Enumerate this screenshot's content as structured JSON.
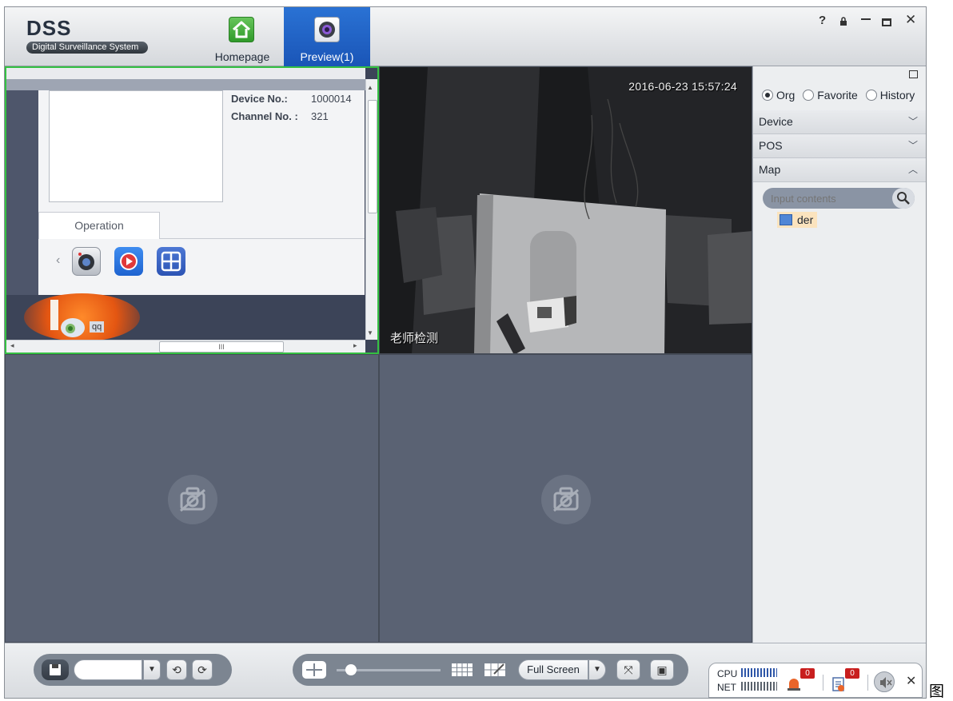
{
  "app": {
    "brand_title": "DSS",
    "brand_subtitle": "Digital Surveillance System",
    "window_controls": [
      "?",
      "lock",
      "minimize",
      "maximize",
      "close"
    ]
  },
  "nav": {
    "tabs": [
      {
        "label": "Homepage",
        "icon": "home-icon",
        "active": false
      },
      {
        "label": "Preview(1)",
        "icon": "camera-preview-icon",
        "active": true
      }
    ]
  },
  "video": {
    "pane1": {
      "device_no_label": "Device No.:",
      "device_no_value": "1000014",
      "channel_no_label": "Channel No. :",
      "channel_no_value": "321",
      "operation_tab": "Operation",
      "app_label": "qq",
      "scrollbar_grip": "III"
    },
    "pane2": {
      "timestamp": "2016-06-23 15:57:24",
      "channel_name": "老师检测"
    }
  },
  "rpanel": {
    "radios": [
      {
        "label": "Org",
        "checked": true
      },
      {
        "label": "Favorite",
        "checked": false
      },
      {
        "label": "History",
        "checked": false
      }
    ],
    "sections": [
      {
        "label": "Device",
        "expanded": false
      },
      {
        "label": "POS",
        "expanded": false
      },
      {
        "label": "Map",
        "expanded": true
      }
    ],
    "search_placeholder": "Input contents",
    "map_item": "der"
  },
  "toolbar": {
    "full_screen_label": "Full Screen",
    "cpu_label": "CPU",
    "net_label": "NET",
    "alarm_count": "0",
    "event_count": "0"
  },
  "colors": {
    "accent_blue": "#1a55b7",
    "selected_pane_border": "#34c042",
    "badge_red": "#c81e1e"
  },
  "page_trailing_char": "图"
}
